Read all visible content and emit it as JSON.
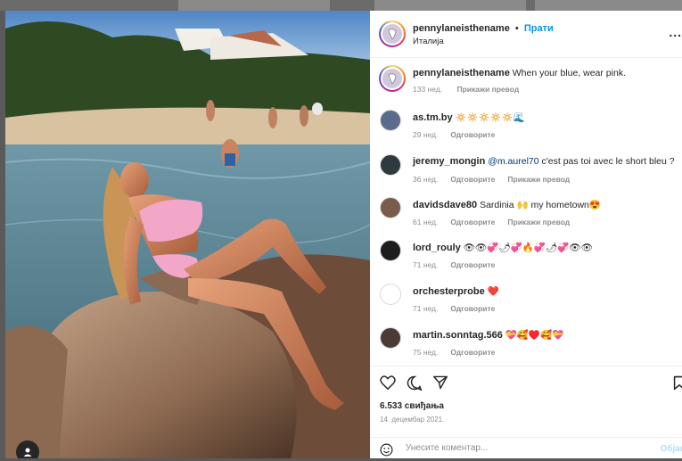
{
  "post": {
    "author": "pennylaneisthename",
    "follow_label": "Прати",
    "separator": "•",
    "location": "Италија",
    "more_label": "...",
    "caption_text": "When your blue, wear pink.",
    "caption_age": "133 нед.",
    "caption_translate": "Прикажи превод"
  },
  "comments": [
    {
      "user": "as.tm.by",
      "text": "🔅🔅🔅🔅🔅🌊",
      "mention": "",
      "age": "29 нед.",
      "reply": "Одговорите",
      "translate": ""
    },
    {
      "user": "jeremy_mongin",
      "text": "c'est pas toi avec le short bleu ?",
      "mention": "@m.aurel70",
      "age": "36 нед.",
      "reply": "Одговорите",
      "translate": "Прикажи превод"
    },
    {
      "user": "davidsdave80",
      "text": "Sardinia 🙌 my hometown😍",
      "mention": "",
      "age": "61 нед.",
      "reply": "Одговорите",
      "translate": "Прикажи превод"
    },
    {
      "user": "lord_rouly",
      "text": "👁👁💞🌶💞🔥💞🌶💞👁👁",
      "mention": "",
      "age": "71 нед.",
      "reply": "Одговорите",
      "translate": ""
    },
    {
      "user": "orchesterprobe",
      "text": "❤️",
      "mention": "",
      "age": "71 нед.",
      "reply": "Одговорите",
      "translate": ""
    },
    {
      "user": "martin.sonntag.566",
      "text": "💝🥰♥️🥰💝",
      "mention": "",
      "age": "75 нед.",
      "reply": "Одговорите",
      "translate": ""
    }
  ],
  "stats": {
    "likes": "6.533 свиђања",
    "date": "14. децембар 2021."
  },
  "add_comment": {
    "placeholder": "Унесите коментар...",
    "post_label": "Објав"
  },
  "icons": [
    "heart-icon",
    "comment-icon",
    "share-icon",
    "bookmark-icon",
    "emoji-icon",
    "user-tag-icon"
  ],
  "colors": {
    "accent": "#0095f6",
    "muted": "#8e8e8e",
    "text": "#262626",
    "like_red": "#ed4956"
  }
}
